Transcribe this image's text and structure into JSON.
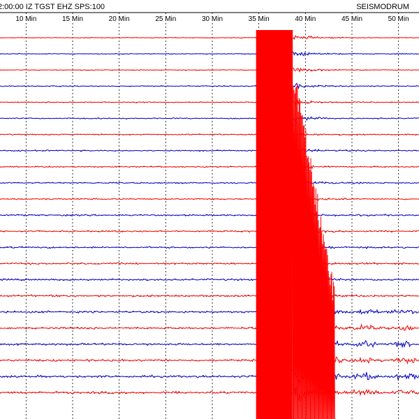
{
  "header": {
    "left": "2:00:00 IZ TGST EHZ SPS:100",
    "right": "SEISMODRUM"
  },
  "colors": {
    "red_trace": "#ff0000",
    "blue_trace": "#0000cc",
    "grid": "#000000",
    "background": "#ffffff"
  },
  "chart_data": {
    "type": "line",
    "title": "",
    "xlabel": "",
    "ylabel": "",
    "x_unit": "Min",
    "x_tick_labels": [
      "10 Min",
      "15 Min",
      "20 Min",
      "25 Min",
      "30 Min",
      "35 Min",
      "40 Min",
      "45 Min",
      "50 Min"
    ],
    "x_ticks": [
      10,
      15,
      20,
      25,
      30,
      35,
      40,
      45,
      50
    ],
    "xlim": [
      7.2,
      52.2
    ],
    "trace_count": 23,
    "trace_colors_sequence": [
      "red",
      "blue"
    ],
    "grid": true,
    "events": [
      {
        "name": "saturated",
        "start_min": 34.7,
        "end_min": 38.6
      },
      {
        "name": "coda",
        "start_min": 38.6,
        "end_min": 52.2
      }
    ]
  }
}
